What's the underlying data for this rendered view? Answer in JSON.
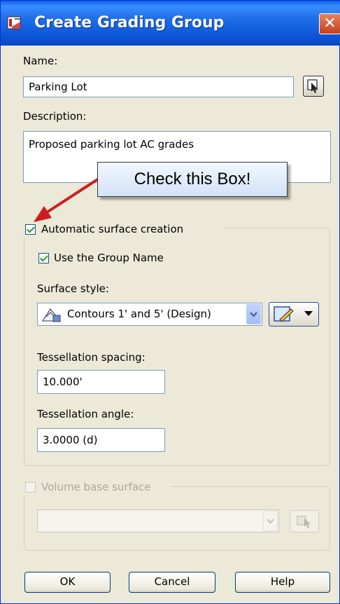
{
  "window": {
    "title": "Create Grading Group",
    "close_glyph": "✕"
  },
  "name": {
    "label": "Name:",
    "value": "Parking Lot"
  },
  "description": {
    "label": "Description:",
    "value": "Proposed parking lot AC grades"
  },
  "callout": {
    "text": "Check this Box!"
  },
  "auto_surface": {
    "checkbox_label": "Automatic surface creation",
    "checked": true,
    "use_group_name_label": "Use the Group Name",
    "use_group_name_checked": true,
    "surface_style_label": "Surface style:",
    "surface_style_value": "Contours 1' and 5' (Design)",
    "tess_spacing_label": "Tessellation spacing:",
    "tess_spacing_value": "10.000'",
    "tess_angle_label": "Tessellation angle:",
    "tess_angle_value": "3.0000 (d)"
  },
  "volume": {
    "checkbox_label": "Volume base surface",
    "checked": false,
    "disabled": true
  },
  "buttons": {
    "ok": "OK",
    "cancel": "Cancel",
    "help": "Help"
  },
  "colors": {
    "titlebar": "#0a5fe6",
    "dialog_bg": "#ece9d8",
    "callout_bg": "#d3e2f8",
    "arrow": "#cc1f1f",
    "check": "#21a121"
  }
}
